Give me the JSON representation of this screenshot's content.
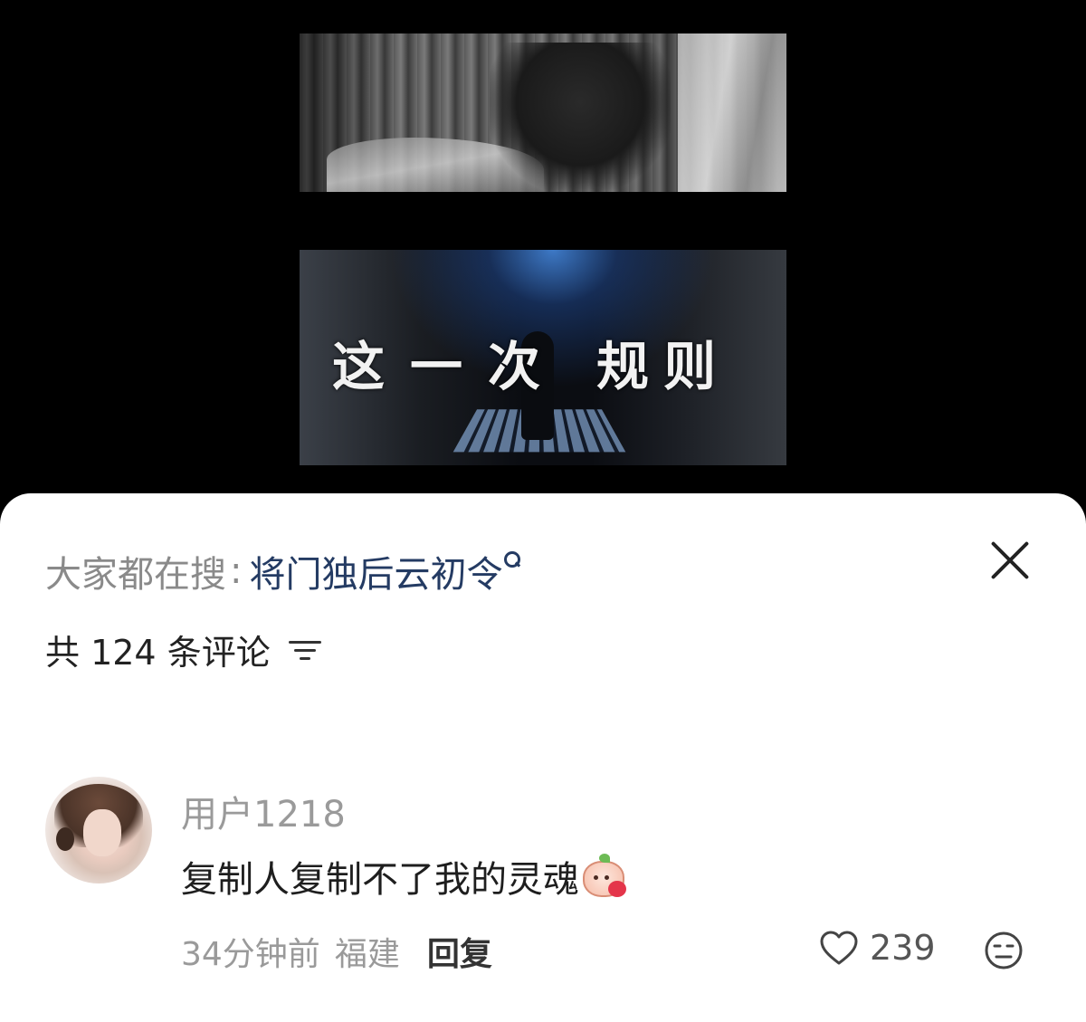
{
  "video": {
    "caption_left": "这一次",
    "caption_right": "规则"
  },
  "search": {
    "prefix": "大家都在搜",
    "colon": ":",
    "term": "将门独后云初令"
  },
  "comments_header": {
    "count_label": "共 124 条评论"
  },
  "comment": {
    "username": "用户1218",
    "text": "复制人复制不了我的灵魂",
    "time": "34分钟前",
    "location": "福建",
    "reply_label": "回复",
    "like_count": "239"
  },
  "icons": {
    "search": "search-icon",
    "close": "close-icon",
    "filter": "filter-icon",
    "heart": "heart-icon",
    "dislike": "dislike-face-icon",
    "emoji": "blushing-peach-emoji"
  },
  "colors": {
    "search_term": "#243b63",
    "muted_text": "#9a9a9a",
    "sheet_background": "#ffffff"
  }
}
